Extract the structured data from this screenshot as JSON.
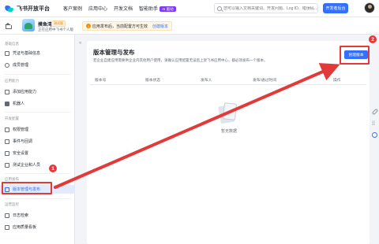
{
  "topbar": {
    "brand": "飞书开放平台",
    "nav": [
      "客户案例",
      "应用中心",
      "开发文档"
    ],
    "nav_ai": "智能助手",
    "nav_ai_badge": "AI 驱动",
    "search_placeholder": "您可以输入文档关键词、开发问题、Log ID、错误码…",
    "backend_button": "开发者后台"
  },
  "appbar": {
    "app_name": "摸鱼湾",
    "app_tag": "测试版",
    "app_sub": "正在应用中飞书个人版",
    "notice_text": "应用发布后，当前配置方可生效",
    "notice_link": "创建版本"
  },
  "sidebar": {
    "groups": {
      "basic": "基础信息",
      "ability": "应用能力",
      "dev": "开发配置",
      "release": "应用发布",
      "ops": "运营监控"
    },
    "items": {
      "credentials": "凭证与基础信息",
      "members": "成员管理",
      "add_ability": "添加应用能力",
      "robot": "机器人",
      "permissions": "权限管理",
      "events": "事件与回调",
      "security": "安全设置",
      "test_enterprise": "测试企业和人员",
      "version": "版本管理与发布",
      "logs": "日志检索",
      "quality": "应用质量看板"
    }
  },
  "main": {
    "title": "版本管理与发布",
    "desc": "若企业自建应用需要供企业内其他用户使用，请确认应用配置无误后上架飞书应用中心，都必须发布一个版本。",
    "create_button": "创建版本",
    "columns": [
      "版本号",
      "版本状态",
      "发布人",
      "发布/通过时间",
      "操作"
    ],
    "empty_text": "暂无数据"
  },
  "annotations": {
    "step1": "1",
    "step2": "2",
    "color": "#e23a3a"
  },
  "colors": {
    "accent": "#3370ff",
    "active_bg": "#e1eaff"
  }
}
